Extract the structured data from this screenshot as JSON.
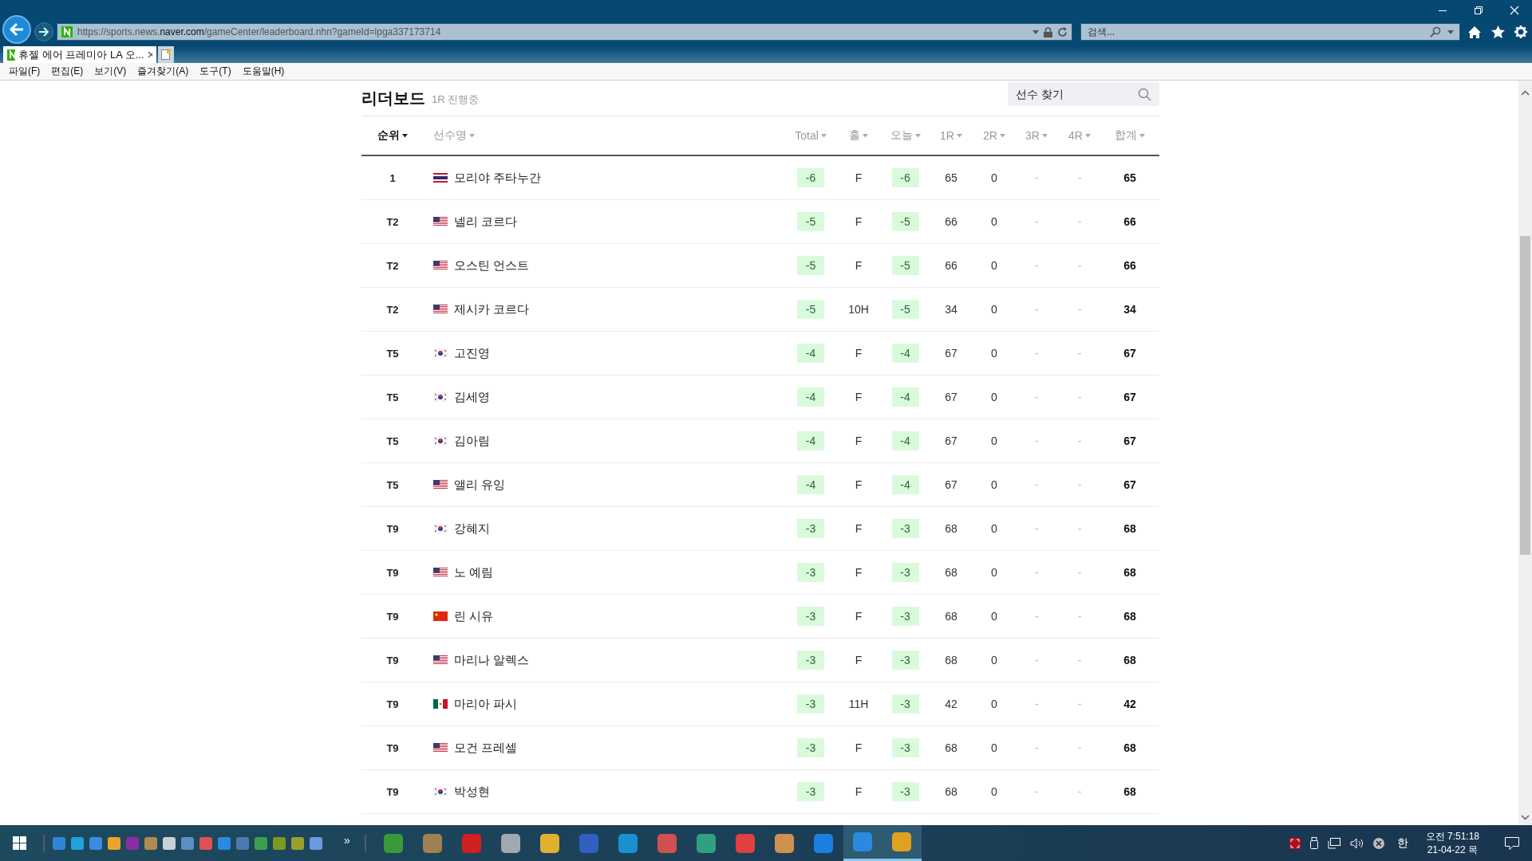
{
  "browser": {
    "url": {
      "prefix": "https://sports.news.",
      "domain": "naver.com",
      "rest": "/gameCenter/leaderboard.nhn?gameId=lpga337173714"
    },
    "search": {
      "placeholder": "검색..."
    },
    "tabs": [
      {
        "title": "휴젤 에어 프레미아 LA 오...",
        "selected": true
      }
    ],
    "menu": [
      "파일(F)",
      "편집(E)",
      "보기(V)",
      "즐겨찾기(A)",
      "도구(T)",
      "도움말(H)"
    ]
  },
  "leaderboard": {
    "title": "리더보드",
    "status": "1R 진행중",
    "player_search": {
      "placeholder": "선수 찾기"
    },
    "columns": [
      {
        "label": "순위",
        "selected": true
      },
      {
        "label": "선수명",
        "selected": false
      },
      {
        "label": "Total",
        "selected": false
      },
      {
        "label": "홀",
        "selected": false
      },
      {
        "label": "오늘",
        "selected": false
      },
      {
        "label": "1R",
        "selected": false
      },
      {
        "label": "2R",
        "selected": false
      },
      {
        "label": "3R",
        "selected": false
      },
      {
        "label": "4R",
        "selected": false
      },
      {
        "label": "합계",
        "selected": false
      }
    ],
    "rows": [
      {
        "rank": "1",
        "kind": "th",
        "name": "모리야 주타누간",
        "total": "-6",
        "hole": "F",
        "today": "-6",
        "r1": "65",
        "r2": "0",
        "r3": "-",
        "r4": "-",
        "sum": "65"
      },
      {
        "rank": "T2",
        "kind": "us",
        "name": "넬리 코르다",
        "total": "-5",
        "hole": "F",
        "today": "-5",
        "r1": "66",
        "r2": "0",
        "r3": "-",
        "r4": "-",
        "sum": "66"
      },
      {
        "rank": "T2",
        "kind": "us",
        "name": "오스틴 언스트",
        "total": "-5",
        "hole": "F",
        "today": "-5",
        "r1": "66",
        "r2": "0",
        "r3": "-",
        "r4": "-",
        "sum": "66"
      },
      {
        "rank": "T2",
        "kind": "us",
        "name": "제시카 코르다",
        "total": "-5",
        "hole": "10H",
        "today": "-5",
        "r1": "34",
        "r2": "0",
        "r3": "-",
        "r4": "-",
        "sum": "34"
      },
      {
        "rank": "T5",
        "kind": "kr",
        "name": "고진영",
        "total": "-4",
        "hole": "F",
        "today": "-4",
        "r1": "67",
        "r2": "0",
        "r3": "-",
        "r4": "-",
        "sum": "67"
      },
      {
        "rank": "T5",
        "kind": "kr",
        "name": "김세영",
        "total": "-4",
        "hole": "F",
        "today": "-4",
        "r1": "67",
        "r2": "0",
        "r3": "-",
        "r4": "-",
        "sum": "67"
      },
      {
        "rank": "T5",
        "kind": "kr",
        "name": "김아림",
        "total": "-4",
        "hole": "F",
        "today": "-4",
        "r1": "67",
        "r2": "0",
        "r3": "-",
        "r4": "-",
        "sum": "67"
      },
      {
        "rank": "T5",
        "kind": "us",
        "name": "앨리 유잉",
        "total": "-4",
        "hole": "F",
        "today": "-4",
        "r1": "67",
        "r2": "0",
        "r3": "-",
        "r4": "-",
        "sum": "67"
      },
      {
        "rank": "T9",
        "kind": "kr",
        "name": "강혜지",
        "total": "-3",
        "hole": "F",
        "today": "-3",
        "r1": "68",
        "r2": "0",
        "r3": "-",
        "r4": "-",
        "sum": "68"
      },
      {
        "rank": "T9",
        "kind": "us",
        "name": "노 예림",
        "total": "-3",
        "hole": "F",
        "today": "-3",
        "r1": "68",
        "r2": "0",
        "r3": "-",
        "r4": "-",
        "sum": "68"
      },
      {
        "rank": "T9",
        "kind": "cn",
        "name": "린 시유",
        "total": "-3",
        "hole": "F",
        "today": "-3",
        "r1": "68",
        "r2": "0",
        "r3": "-",
        "r4": "-",
        "sum": "68"
      },
      {
        "rank": "T9",
        "kind": "us",
        "name": "마리나 알렉스",
        "total": "-3",
        "hole": "F",
        "today": "-3",
        "r1": "68",
        "r2": "0",
        "r3": "-",
        "r4": "-",
        "sum": "68"
      },
      {
        "rank": "T9",
        "kind": "mx",
        "name": "마리아 파시",
        "total": "-3",
        "hole": "11H",
        "today": "-3",
        "r1": "42",
        "r2": "0",
        "r3": "-",
        "r4": "-",
        "sum": "42"
      },
      {
        "rank": "T9",
        "kind": "us",
        "name": "모건 프레셀",
        "total": "-3",
        "hole": "F",
        "today": "-3",
        "r1": "68",
        "r2": "0",
        "r3": "-",
        "r4": "-",
        "sum": "68"
      },
      {
        "rank": "T9",
        "kind": "kr",
        "name": "박성현",
        "total": "-3",
        "hole": "F",
        "today": "-3",
        "r1": "68",
        "r2": "0",
        "r3": "-",
        "r4": "-",
        "sum": "68"
      }
    ]
  },
  "taskbar": {
    "overflow": "»",
    "quick_launch": [
      {
        "color": "#2f86d6"
      },
      {
        "color": "#1fa3d8"
      },
      {
        "color": "#3b8be0"
      },
      {
        "color": "#e8a42b"
      },
      {
        "color": "#8a2da0"
      },
      {
        "color": "#b08a50"
      },
      {
        "color": "#c8d0d8"
      },
      {
        "color": "#5a8fc0"
      },
      {
        "color": "#e05050"
      },
      {
        "color": "#2a8ae0"
      },
      {
        "color": "#4a7ab0"
      },
      {
        "color": "#3aa050"
      },
      {
        "color": "#7a9a20"
      },
      {
        "color": "#9aa030"
      },
      {
        "color": "#6a9ae0"
      }
    ],
    "pinned": [
      {
        "color": "#3a9a3a",
        "running": false
      },
      {
        "color": "#a08050",
        "running": false
      },
      {
        "color": "#d02020",
        "running": false
      },
      {
        "color": "#a0a8b0",
        "running": false
      },
      {
        "color": "#e0b030",
        "running": false
      },
      {
        "color": "#3060c0",
        "running": false
      },
      {
        "color": "#1a90d0",
        "running": false
      },
      {
        "color": "#d05050",
        "running": false
      },
      {
        "color": "#30a080",
        "running": false
      },
      {
        "color": "#e04040",
        "running": false
      },
      {
        "color": "#d09050",
        "running": false
      },
      {
        "color": "#1a80e0",
        "running": false
      },
      {
        "color": "#2a8ae0",
        "running": true
      },
      {
        "color": "#e0a020",
        "running": true
      }
    ],
    "ime": "한",
    "time": "오전 7:51:18",
    "date": "21-04-22 목"
  }
}
